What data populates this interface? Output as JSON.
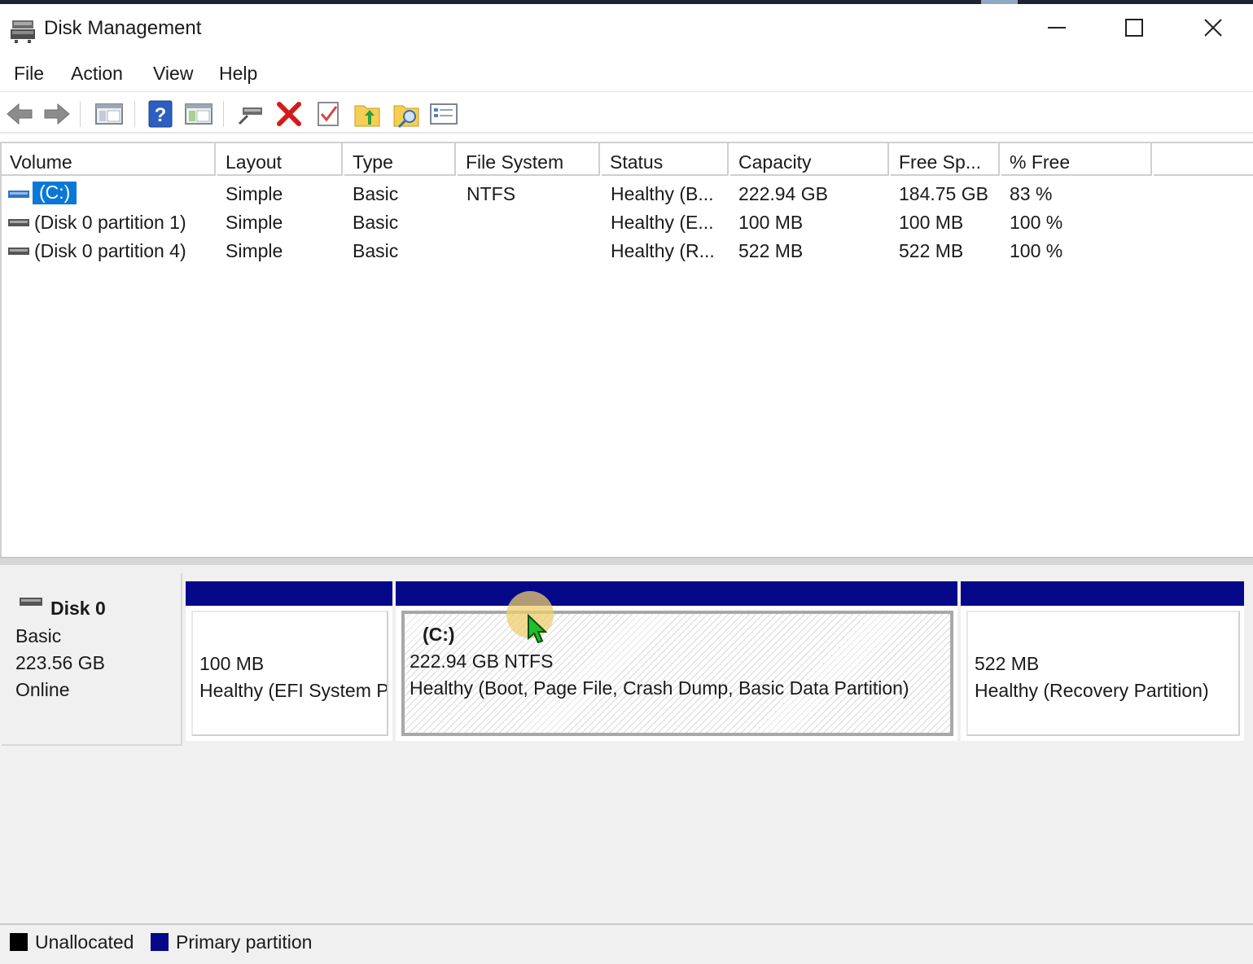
{
  "window": {
    "title": "Disk Management",
    "icon": "disk-management-icon"
  },
  "menu": [
    "File",
    "Action",
    "View",
    "Help"
  ],
  "toolbar": {
    "buttons": [
      "back-arrow-icon",
      "forward-arrow-icon",
      "console-tree-icon",
      "help-icon",
      "show-pane-icon",
      "connect-drive-icon",
      "delete-icon",
      "properties-check-icon",
      "open-folder-icon",
      "explore-icon",
      "details-list-icon"
    ]
  },
  "columns": [
    "Volume",
    "Layout",
    "Type",
    "File System",
    "Status",
    "Capacity",
    "Free Sp...",
    "% Free"
  ],
  "volumes": [
    {
      "volume": "(C:)",
      "layout": "Simple",
      "type": "Basic",
      "fs": "NTFS",
      "status": "Healthy (B...",
      "capacity": "222.94 GB",
      "free": "184.75 GB",
      "pct": "83 %"
    },
    {
      "volume": "(Disk 0 partition 1)",
      "layout": "Simple",
      "type": "Basic",
      "fs": "",
      "status": "Healthy (E...",
      "capacity": "100 MB",
      "free": "100 MB",
      "pct": "100 %"
    },
    {
      "volume": "(Disk 0 partition 4)",
      "layout": "Simple",
      "type": "Basic",
      "fs": "",
      "status": "Healthy (R...",
      "capacity": "522 MB",
      "free": "522 MB",
      "pct": "100 %"
    }
  ],
  "disk": {
    "name": "Disk 0",
    "type": "Basic",
    "size": "223.56 GB",
    "state": "Online",
    "partitions": [
      {
        "label": "",
        "line1": "100 MB",
        "line2": "Healthy (EFI System Partition)"
      },
      {
        "label": "(C:)",
        "line1": "222.94 GB NTFS",
        "line2": "Healthy (Boot, Page File, Crash Dump, Basic Data Partition)"
      },
      {
        "label": "",
        "line1": "522 MB",
        "line2": "Healthy (Recovery Partition)"
      }
    ]
  },
  "legend": [
    {
      "label": "Unallocated",
      "color": "#000000"
    },
    {
      "label": "Primary partition",
      "color": "#06088a"
    }
  ],
  "colors": {
    "primary_partition": "#06088a",
    "selection": "#0a78d7"
  }
}
